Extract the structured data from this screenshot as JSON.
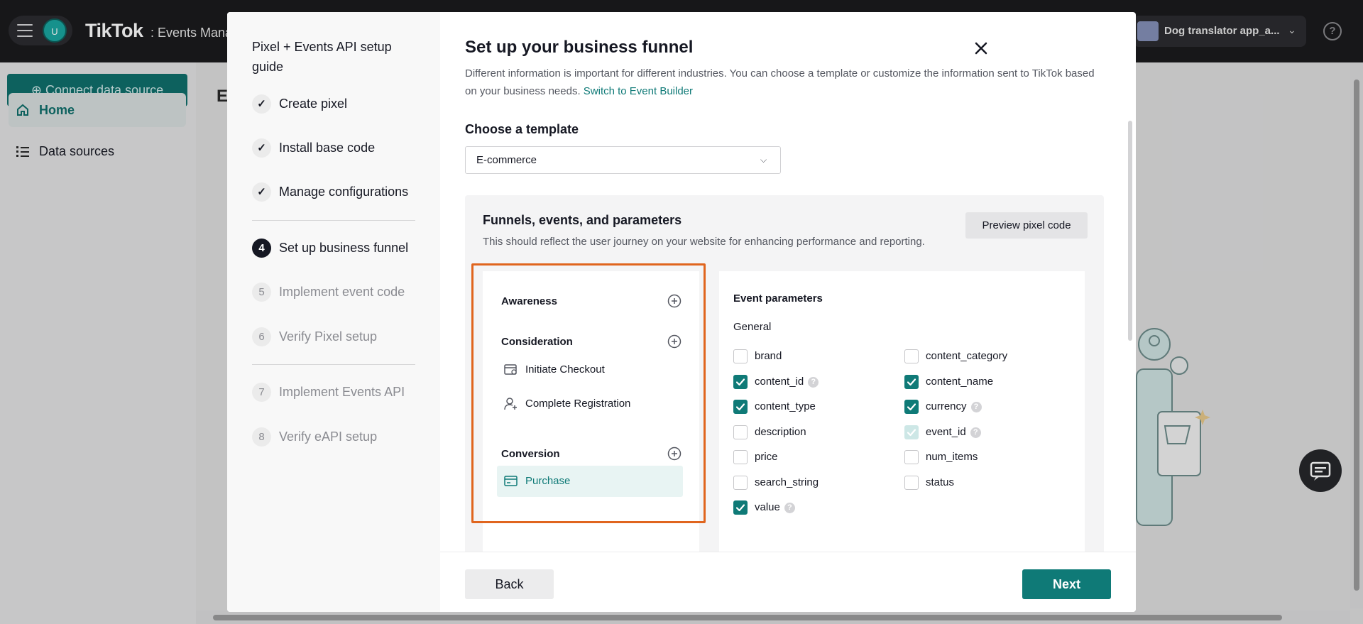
{
  "app": {
    "avatar_initial": "U",
    "brand": "TikTok",
    "brand_sub": ": Events Mana",
    "account_name": "Dog translator app_a...",
    "help_glyph": "?",
    "connect_label": "⊕ Connect data source",
    "sidebar": [
      {
        "label": "Home",
        "icon": "home-icon",
        "active": true
      },
      {
        "label": "Data sources",
        "icon": "list-icon",
        "active": false
      }
    ],
    "page_title_fragment": "E"
  },
  "guide": {
    "title": "Pixel + Events API setup guide",
    "steps": [
      {
        "num": "",
        "label": "Create pixel",
        "state": "done"
      },
      {
        "num": "",
        "label": "Install base code",
        "state": "done"
      },
      {
        "num": "",
        "label": "Manage configurations",
        "state": "done"
      },
      {
        "num": "4",
        "label": "Set up business funnel",
        "state": "current"
      },
      {
        "num": "5",
        "label": "Implement event code",
        "state": "todo"
      },
      {
        "num": "6",
        "label": "Verify Pixel setup",
        "state": "todo"
      },
      {
        "num": "7",
        "label": "Implement Events API",
        "state": "todo"
      },
      {
        "num": "8",
        "label": "Verify eAPI setup",
        "state": "todo"
      }
    ]
  },
  "main": {
    "title": "Set up your business funnel",
    "intro": "Different information is important for different industries. You can choose a template or customize the information sent to TikTok based on your business needs.",
    "intro_link": "Switch to Event Builder",
    "choose_label": "Choose a template",
    "template_value": "E-commerce",
    "panel_title": "Funnels, events, and parameters",
    "panel_desc": "This should reflect the user journey on your website for enhancing performance and reporting.",
    "preview_label": "Preview pixel code",
    "stages": [
      {
        "name": "Awareness",
        "events": []
      },
      {
        "name": "Consideration",
        "events": [
          {
            "label": "Initiate Checkout",
            "icon": "checkout-icon",
            "selected": false
          },
          {
            "label": "Complete Registration",
            "icon": "user-add-icon",
            "selected": false
          }
        ]
      },
      {
        "name": "Conversion",
        "events": [
          {
            "label": "Purchase",
            "icon": "card-icon",
            "selected": true
          }
        ]
      }
    ],
    "params_title": "Event parameters",
    "params_group": "General",
    "params": [
      {
        "name": "brand",
        "checked": false,
        "help": false
      },
      {
        "name": "content_category",
        "checked": false,
        "help": false
      },
      {
        "name": "content_id",
        "checked": true,
        "help": true
      },
      {
        "name": "content_name",
        "checked": true,
        "help": false
      },
      {
        "name": "content_type",
        "checked": true,
        "help": false
      },
      {
        "name": "currency",
        "checked": true,
        "help": true
      },
      {
        "name": "description",
        "checked": false,
        "help": false
      },
      {
        "name": "event_id",
        "checked": true,
        "disabled": true,
        "help": true
      },
      {
        "name": "price",
        "checked": false,
        "help": false
      },
      {
        "name": "num_items",
        "checked": false,
        "help": false
      },
      {
        "name": "search_string",
        "checked": false,
        "help": false
      },
      {
        "name": "status",
        "checked": false,
        "help": false
      },
      {
        "name": "value",
        "checked": true,
        "help": true
      }
    ]
  },
  "footer": {
    "back_label": "Back",
    "next_label": "Next"
  },
  "colors": {
    "accent": "#0f7a77",
    "highlight_border": "#e0651e",
    "dark": "#161823"
  }
}
